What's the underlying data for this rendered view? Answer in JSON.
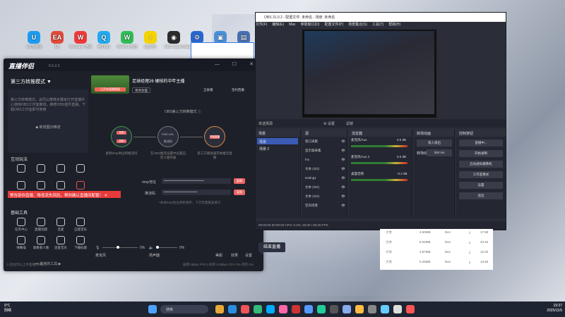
{
  "desktop_icons": [
    {
      "label": "UU加速器",
      "color": "#1d9bf0",
      "glyph": "U"
    },
    {
      "label": "EA",
      "color": "#e24a3b",
      "glyph": "EA"
    },
    {
      "label": "WeGame 游戏",
      "color": "#ef3a3a",
      "glyph": "W"
    },
    {
      "label": "腾讯QQ",
      "color": "#22aaee",
      "glyph": "Q"
    },
    {
      "label": "WeChat 微信",
      "color": "#2fbd55",
      "glyph": "W"
    },
    {
      "label": "QQ音乐",
      "color": "#f5d200",
      "glyph": "♪"
    },
    {
      "label": "OBS Studio",
      "color": "#2b2b2b",
      "glyph": "◉"
    },
    {
      "label": "Wallpaper Engine",
      "color": "#2a66cc",
      "glyph": "⚙"
    },
    {
      "label": "",
      "color": "#4a8fd8",
      "glyph": "▣"
    },
    {
      "label": "",
      "color": "#4a6fb0",
      "glyph": "▤"
    }
  ],
  "helper": {
    "app_name": "直播伴侣",
    "version": "6.5.2.3",
    "mode_label": "第三方转推模式 ▼",
    "mode_desc": "第三方转推模式，会同以推荐步骤来打开直播中心使用OBS工作室推流，推荐OBS插件直播，下载OBS工作室即可使用",
    "tutorial_label": "◆ 新增图示推流",
    "interact_section": "互动玩法",
    "tools_section": "基础工具",
    "interact_tools": [
      "",
      "",
      "",
      "",
      "弹幕回复",
      "主播口袋",
      "短视频",
      "弹幕玩家"
    ],
    "basic_tools": [
      "任务中心",
      "直播话题",
      "连麦",
      "正能音乐",
      "弹幕墙",
      "观看者人数",
      "连麦音乐",
      "下播标题"
    ],
    "more_label": "••• 其他的工具 ▶",
    "banner": "警告助你直播、降低流失风险，帮你确认直播间配置！ ✕",
    "stream_title": "足球经理26 硬核的中年主播",
    "thumb_btn": "已开启直播截图",
    "cover_btn": "更改封面",
    "fullscreen_btn": "全屏播",
    "share_btn": "签约西番",
    "obs_mode": "OBS第三方转推模式 ⓘ",
    "steps": [
      {
        "btn": "复制",
        "text": "复制rtmp地址和推流码"
      },
      {
        "btn": "复制",
        "text": "在OBS推流设置中设置自定义服务器"
      },
      {
        "btn": "开始直播",
        "text": "第三方播放器开始推流直播"
      }
    ],
    "step_mid_label": "FMS URL",
    "step_mid_sub": "推流码",
    "rtmp_label": "rtmp地址",
    "rtmp_value": "••••••••••••••••••••••••••••••••••••",
    "key_label": "推流码",
    "key_value": "••••••••••••••••••••••••••••••",
    "copy_label": "复制",
    "tip": "*本地rtmp地址更新频率，下次无需重复填写",
    "mic_label": "麦克风",
    "mic_pct": "0%",
    "speaker_label": "扬声器",
    "speaker_pct": "0%",
    "beauty_label": "美颜",
    "effect_label": "效果",
    "settings_label": "设置",
    "golive_label": "结束直播",
    "status_text": "⊙ 后台可以上手直播(待审)",
    "metrics": "弱网 0kbps   FPS 0   码率 0.0kbps   CPU 0%   内存 0%"
  },
  "obs": {
    "title": "OBS 31.0.2 - 配置文件: 未命名 - 场景: 未命名",
    "menu": [
      "文件(F)",
      "编辑(E)",
      "Mac",
      "停靠窗口(D)",
      "配置文件(P)",
      "场景集合(S)",
      "工具(T)",
      "帮助(H)"
    ],
    "no_source": "未选择源",
    "settings_label": "⚙ 设置",
    "filters_label": "滤镜",
    "docks": {
      "scenes": "场景",
      "sources": "源",
      "mixer": "混音器",
      "transitions": "转场动画",
      "controls": "控制按钮"
    },
    "scenes": [
      "场景",
      "场景 2"
    ],
    "sources": [
      "窗口采集",
      "显示器采集",
      "fns",
      "文本 (GD)",
      "texting1",
      "文本 (GD)",
      "文本 (GD)",
      "空白场景"
    ],
    "mixer": [
      {
        "name": "麦克风/Aux",
        "db": "0.0 dB"
      },
      {
        "name": "麦克风/Aux 2",
        "db": "0.0 dB"
      },
      {
        "name": "桌面音频",
        "db": "-0.2 dB"
      }
    ],
    "transition": "渐入渐出",
    "duration_label": "时长",
    "duration": "250 ms",
    "controls": [
      "直播中...",
      "开始录制",
      "启动虚拟摄像机",
      "工作室模式",
      "设置",
      "退出"
    ],
    "status": "00:00:00     00:00:00     CPU: 0.4%, 60.00 / 60.00 FPS"
  },
  "files": [
    {
      "col1": "小文",
      "size": "4.50MB",
      "col3": "Dec",
      "col4": "17.85"
    },
    {
      "col1": "小文",
      "size": "8.04MB",
      "col3": "Nov",
      "col4": "23.42"
    },
    {
      "col1": "小文",
      "size": "4.87MB",
      "col3": "Dec",
      "col4": "12.02"
    },
    {
      "col1": "小文",
      "size": "5.25MB",
      "col3": "Nov",
      "col4": "13.60"
    }
  ],
  "taskbar": {
    "temp": "9°C",
    "weather": "阴晴",
    "search": "搜索",
    "time": "19:37",
    "date": "2025/11/5"
  }
}
